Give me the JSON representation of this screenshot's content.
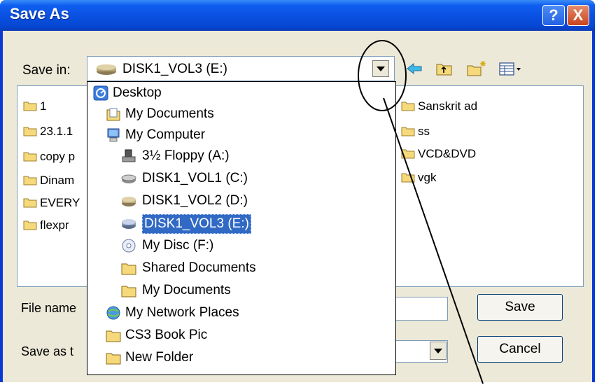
{
  "window": {
    "title": "Save As"
  },
  "title_buttons": {
    "help": "?",
    "close": "X"
  },
  "save_in": {
    "label": "Save in:",
    "value": "DISK1_VOL3 (E:)"
  },
  "file_list": {
    "left_items": [
      "1",
      "23.1.1",
      "copy p",
      "Dinam",
      "EVERY",
      "flexpr"
    ],
    "right_items": [
      "Sanskrit ad",
      "ss",
      "VCD&DVD",
      "vgk"
    ]
  },
  "dropdown": {
    "items": [
      {
        "label": "Desktop",
        "icon": "desktop-icon"
      },
      {
        "label": "My Documents",
        "icon": "my-documents-icon"
      },
      {
        "label": "My Computer",
        "icon": "my-computer-icon"
      },
      {
        "label": "3½ Floppy (A:)",
        "icon": "floppy-icon"
      },
      {
        "label": "DISK1_VOL1 (C:)",
        "icon": "drive-icon"
      },
      {
        "label": "DISK1_VOL2 (D:)",
        "icon": "drive-icon"
      },
      {
        "label": "DISK1_VOL3 (E:)",
        "icon": "drive-icon",
        "selected": true
      },
      {
        "label": "My Disc (F:)",
        "icon": "cd-icon"
      },
      {
        "label": "Shared Documents",
        "icon": "folder-icon"
      },
      {
        "label": "My Documents",
        "icon": "folder-icon"
      },
      {
        "label": "My Network Places",
        "icon": "network-icon"
      },
      {
        "label": "CS3 Book Pic",
        "icon": "folder-icon"
      },
      {
        "label": "New Folder",
        "icon": "folder-icon"
      }
    ]
  },
  "file_name": {
    "label": "File name",
    "value": ""
  },
  "save_as_type": {
    "label": "Save as t",
    "value": ""
  },
  "buttons": {
    "save": "Save",
    "cancel": "Cancel"
  },
  "colors": {
    "title_bar": "#0a4fe0",
    "selection": "#316ac5",
    "dialog_bg": "#ece9d8"
  }
}
